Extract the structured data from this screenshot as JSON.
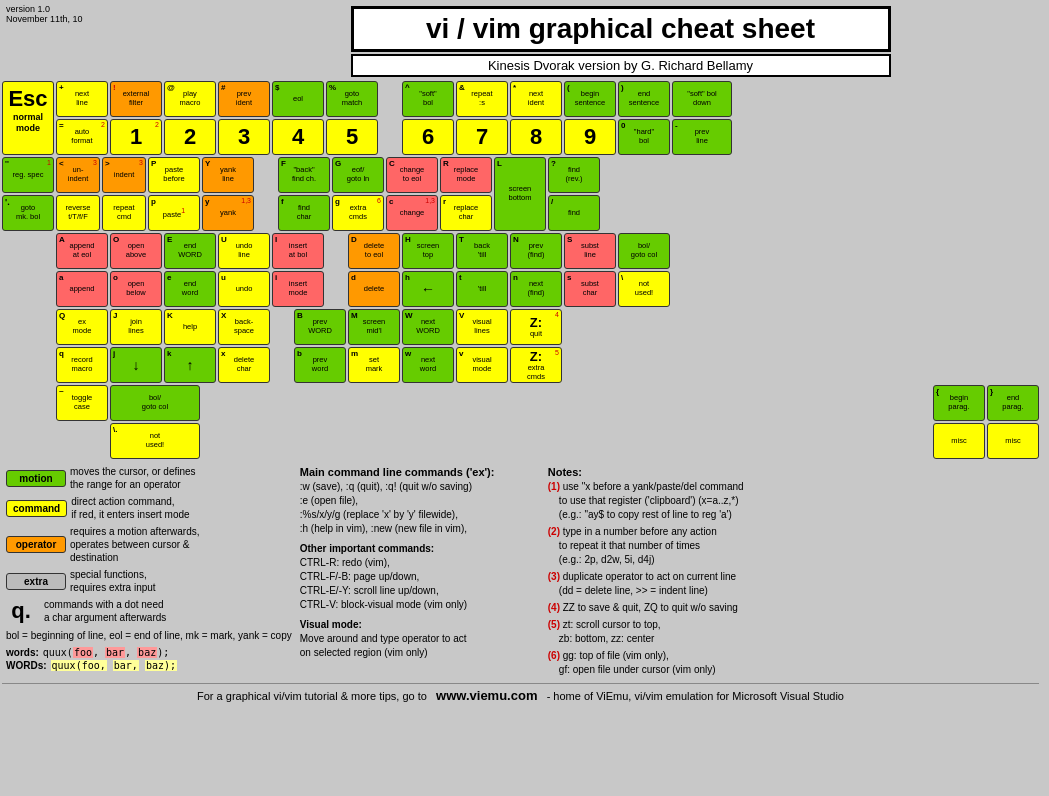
{
  "page": {
    "version": "version 1.0\nNovember 11th, 10",
    "title": "vi / vim graphical cheat sheet",
    "subtitle": "Kinesis Dvorak version by G. Richard Bellamy"
  },
  "colors": {
    "motion": "#66cc00",
    "command": "#ffff00",
    "operator": "#ff9900",
    "insert": "#ff6666",
    "extra": "#cccccc",
    "white": "#ffffff"
  },
  "legend": {
    "motion_label": "motion",
    "motion_desc": "moves the cursor, or defines\nthe range for an operator",
    "command_label": "command",
    "command_desc": "direct action command,\nif red, it enters insert mode",
    "operator_label": "operator",
    "operator_desc": "requires a motion afterwards,\noperates between cursor &\ndestination",
    "extra_label": "extra",
    "extra_desc": "special functions,\nrequires extra input",
    "dot_desc": "commands with a dot need\na char argument afterwards",
    "bol_eol": "bol = beginning of line, eol = end of line,\nmk = mark, yank = copy",
    "words_label": "words:",
    "words_ex": "quux(foo, bar, baz);",
    "WORDS_label": "WORDs:",
    "WORDS_ex": "quux(foo, bar, baz);"
  },
  "main_commands": {
    "title": "Main command line commands ('ex'):",
    "lines": [
      ":w (save), :q (quit), :q! (quit w/o saving)",
      ":e (open file),",
      ":%s/x/y/g (replace 'x' by 'y' filewide),",
      ":h (help in vim), :new (new file in vim),",
      "",
      "Other important commands:",
      "CTRL-R: redo (vim),",
      "CTRL-F/-B: page up/down,",
      "CTRL-E/-Y: scroll line up/down,",
      "CTRL-V: block-visual mode (vim only)",
      "",
      "Visual mode:",
      "Move around and type operator to act",
      "on selected region (vim only)"
    ]
  },
  "notes": {
    "title": "Notes:",
    "items": [
      "(1) use \"x before a yank/paste/del command\n    to use that register ('clipboard') (x=a..z,*)\n    (e.g.: \"ay$ to copy rest of line to reg 'a')",
      "(2) type in a number before any action\n    to repeat it that number of times\n    (e.g.: 2p, d2w, 5i, d4j)",
      "(3) duplicate operator to act on current line\n    (dd = delete line, >> = indent line)",
      "(4) ZZ to save & quit, ZQ to quit w/o saving",
      "(5) zt: scroll cursor to top,\n    zb: bottom, zz: center",
      "(6) gg: top of file (vim only),\n    gf: open file under cursor (vim only)"
    ]
  },
  "footer": {
    "text": "For a graphical vi/vim tutorial & more tips, go to",
    "url": "www.viemu.com",
    "suffix": "- home of ViEmu, vi/vim emulation for Microsoft Visual Studio"
  }
}
